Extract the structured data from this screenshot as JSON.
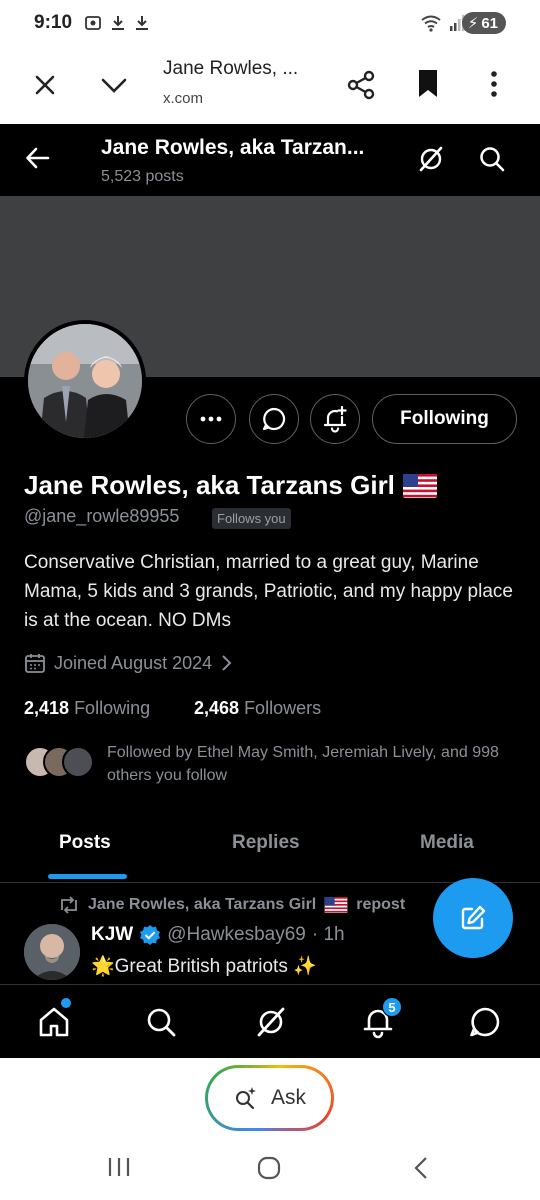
{
  "status": {
    "time": "9:10",
    "battery": "61"
  },
  "browser": {
    "title": "Jane Rowles, ...",
    "domain": "x.com"
  },
  "header": {
    "name": "Jane Rowles, aka Tarzan...",
    "posts": "5,523 posts"
  },
  "profile": {
    "display_name": "Jane Rowles, aka Tarzans Girl",
    "flag": "us-flag",
    "handle": "@jane_rowle89955",
    "follows_you": "Follows you",
    "bio": "Conservative Christian, married to a great guy, Marine Mama, 5 kids and 3 grands, Patriotic, and my happy place is at the ocean. NO DMs",
    "joined": "Joined August 2024",
    "following_button": "Following",
    "following_count": "2,418",
    "following_label": "Following",
    "followers_count": "2,468",
    "followers_label": "Followers",
    "followed_by": "Followed by Ethel May Smith, Jeremiah Lively, and 998 others you follow"
  },
  "tabs": [
    {
      "label": "Posts",
      "active": true
    },
    {
      "label": "Replies",
      "active": false
    },
    {
      "label": "Media",
      "active": false
    }
  ],
  "tweet": {
    "repost_text": "Jane Rowles, aka Tarzans Girl",
    "repost_suffix": "repost",
    "author": "KJW",
    "handle": "@Hawkesbay69",
    "time": "· 1h",
    "text": "🌟Great British patriots ✨"
  },
  "bottom_nav": {
    "notifications_count": "5"
  },
  "system": {
    "ask_label": "Ask"
  },
  "colors": {
    "accent": "#1d9bf0",
    "background": "#000000",
    "banner": "#3e4042",
    "muted": "#8b9096"
  }
}
